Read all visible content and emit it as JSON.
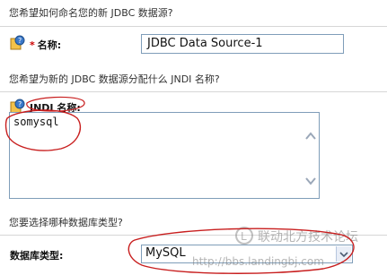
{
  "section1": {
    "question": "您希望如何命名您的新 JDBC 数据源?",
    "name_label": "名称:",
    "required_mark": "*",
    "name_value": "JDBC Data Source-1"
  },
  "section2": {
    "question": "您希望为新的 JDBC 数据源分配什么 JNDI 名称?",
    "jndi_label": "JNDI 名称:",
    "jndi_value": "somysql"
  },
  "section3": {
    "question": "您要选择哪种数据库类型?",
    "dbtype_label": "数据库类型:",
    "dbtype_value": "MySQL"
  },
  "watermark": {
    "line1": "联动北方技术论坛",
    "line2": "http://bbs.landingbj.com"
  },
  "colors": {
    "annotation": "#c81e1e",
    "field_border": "#7f9db9",
    "separator": "#d6d6d6"
  }
}
